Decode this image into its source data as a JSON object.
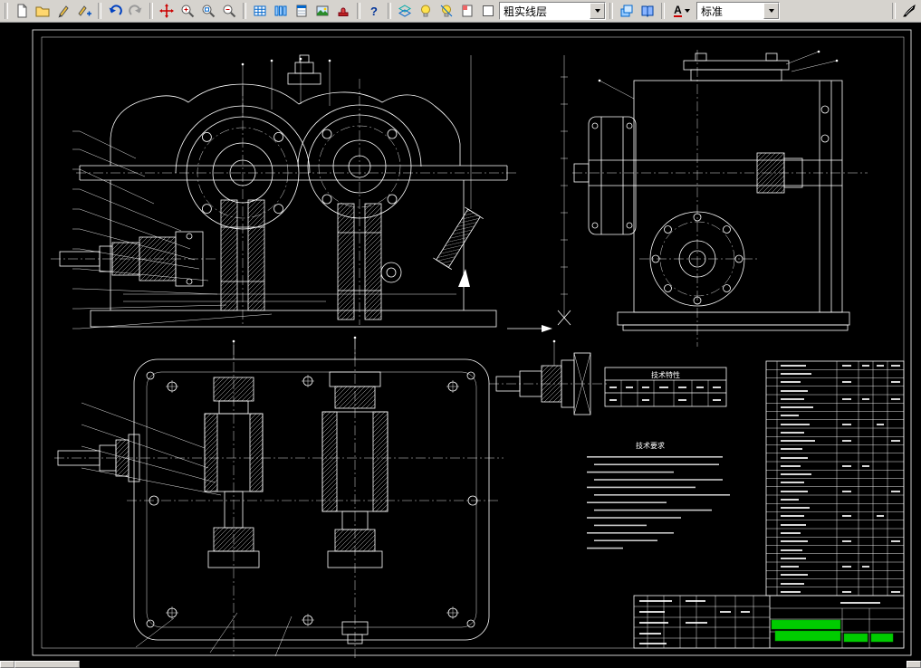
{
  "toolbar": {
    "layer_combo_value": "粗实线层",
    "style_combo_value": "标准",
    "help_glyph": "?",
    "style_letter": "A"
  },
  "drawing": {
    "tech_requirements_title": "技术要求",
    "tech_characteristics_title": "技术特性"
  },
  "colors": {
    "canvas_bg": "#000000",
    "line": "#ffffff",
    "highlight_green": "#00cc00",
    "toolbar_bg": "#d6d3ce"
  }
}
